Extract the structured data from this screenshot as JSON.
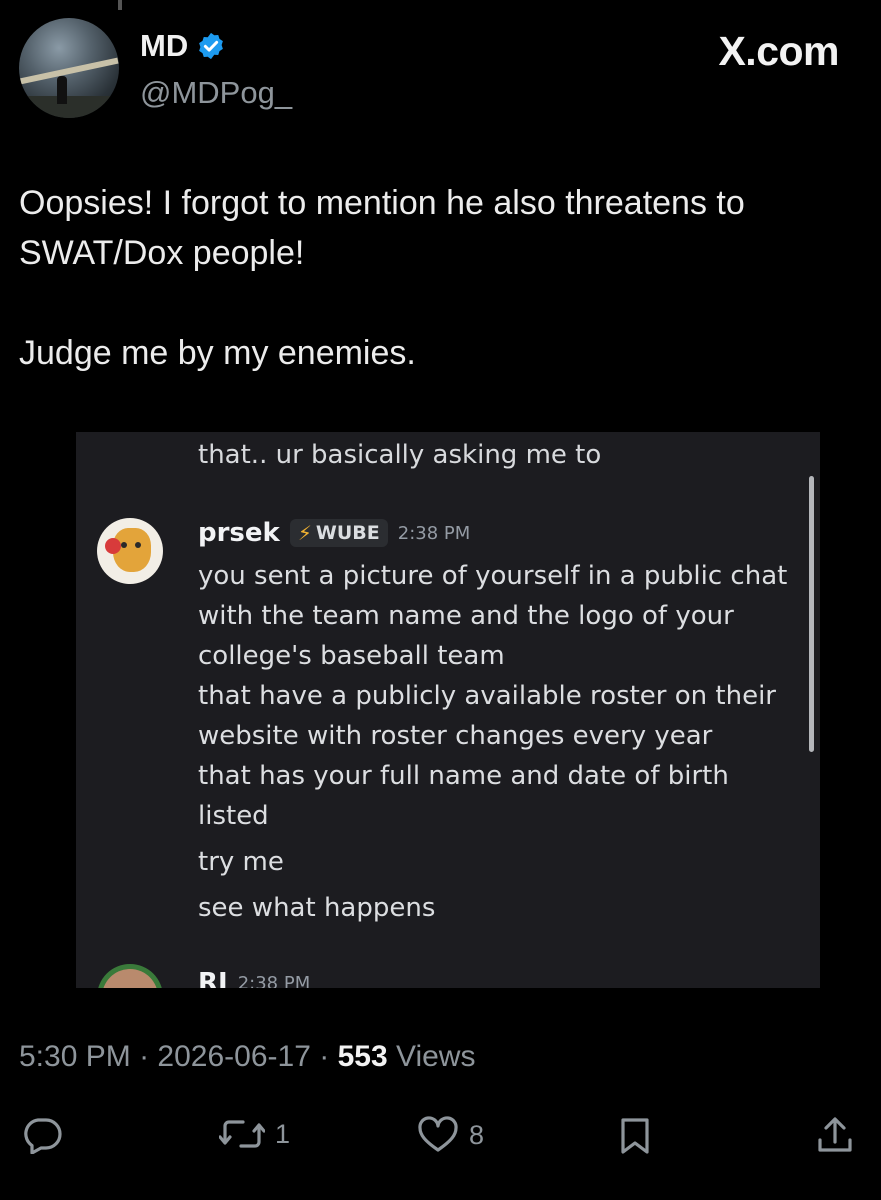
{
  "author": {
    "name": "MD",
    "handle": "@MDPog_",
    "brand": "X.com"
  },
  "tweet": {
    "text": "Oopsies! I forgot to mention he also threatens to SWAT/Dox people!\n\nJudge me by my enemies."
  },
  "embed": {
    "previous_line": "that.. ur basically asking me to",
    "message": {
      "username": "prsek",
      "tag": "WUBE",
      "time": "2:38 PM",
      "lines": [
        "you sent a picture of yourself in a public chat",
        "with the team name and the logo of your",
        "college's baseball team",
        "that have a publicly available roster on their",
        "website with roster changes every year",
        "that has your full name and date of birth",
        "listed",
        "try me",
        "see what happens"
      ]
    },
    "next_message": {
      "username": "RJ",
      "time": "2:38 PM"
    }
  },
  "meta": {
    "time": "5:30 PM",
    "separator": "·",
    "date": "2026-06-17",
    "views_count": "553",
    "views_label": "Views"
  },
  "actions": {
    "reply_icon": "reply-icon",
    "retweet_count": "1",
    "like_count": "8",
    "bookmark_icon": "bookmark-icon",
    "share_icon": "share-icon"
  },
  "colors": {
    "background": "#000000",
    "verified": "#1d9bf0",
    "embed_background": "#1c1c20",
    "muted_text": "#8e959b"
  }
}
